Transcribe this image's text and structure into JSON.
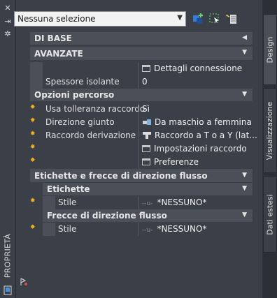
{
  "palette_title": "PROPRIETÀ",
  "selection": {
    "value": "Nessuna selezione"
  },
  "tabs": [
    {
      "label": "Design"
    },
    {
      "label": "Visualizzazione"
    },
    {
      "label": "Dati estesi"
    }
  ],
  "sections": {
    "base": "DI BASE",
    "avanzate": "AVANZATE",
    "percorso": "Opzioni percorso",
    "etichette_frecce": "Etichette e frecce di direzione flusso",
    "etichette": "Etichette",
    "frecce": "Frecce di direzione flusso"
  },
  "rows": {
    "dettagli": {
      "value": "Dettagli connessione"
    },
    "spessore": {
      "label": "Spessore isolante",
      "value": "0"
    },
    "tolleranza": {
      "label": "Usa tolleranza raccordo",
      "value": "Sì"
    },
    "direzione": {
      "label": "Direzione giunto",
      "value": "Da maschio a femmina"
    },
    "raccordo": {
      "label": "Raccordo derivazione",
      "value": "Raccordo a T o a Y (lat..."
    },
    "impostazioni": {
      "value": "Impostazioni raccordo"
    },
    "preferenze": {
      "value": "Preferenze"
    },
    "stile_etichette": {
      "label": "Stile",
      "value": "*NESSUNO*"
    },
    "stile_frecce": {
      "label": "Stile",
      "value": "*NESSUNO*"
    }
  },
  "style_prefix": "--u-"
}
